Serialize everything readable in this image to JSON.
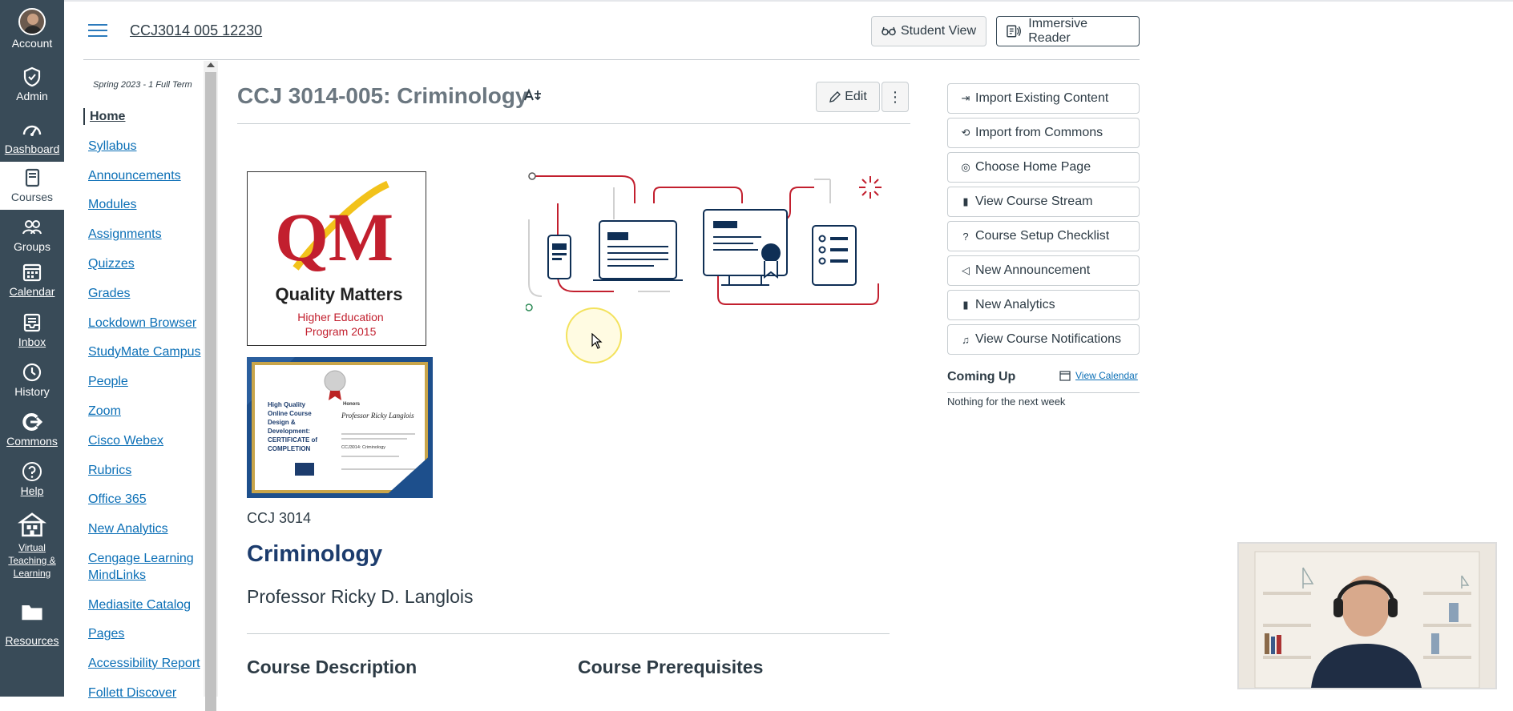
{
  "global_nav": [
    {
      "label": "Account",
      "icon": "avatar"
    },
    {
      "label": "Admin",
      "icon": "shield-icon"
    },
    {
      "label": "Dashboard",
      "icon": "dashboard-icon"
    },
    {
      "label": "Courses",
      "icon": "book-icon"
    },
    {
      "label": "Groups",
      "icon": "groups-icon"
    },
    {
      "label": "Calendar",
      "icon": "calendar-icon"
    },
    {
      "label": "Inbox",
      "icon": "inbox-icon"
    },
    {
      "label": "History",
      "icon": "clock-icon"
    },
    {
      "label": "Commons",
      "icon": "commons-icon"
    },
    {
      "label": "Help",
      "icon": "help-icon"
    },
    {
      "label": "Virtual Teaching & Learning",
      "icon": "building-icon"
    },
    {
      "label": "Resources",
      "icon": "folder-icon"
    }
  ],
  "header": {
    "breadcrumb": "CCJ3014 005 12230",
    "student_view": "Student View",
    "immersive_reader": "Immersive Reader"
  },
  "course_nav": {
    "term": "Spring 2023 - 1 Full Term",
    "links": [
      "Home",
      "Syllabus",
      "Announcements",
      "Modules",
      "Assignments",
      "Quizzes",
      "Grades",
      "Lockdown Browser",
      "StudyMate Campus",
      "People",
      "Zoom",
      "Cisco Webex",
      "Rubrics",
      "Office 365",
      "New Analytics",
      "Cengage Learning MindLinks",
      "Mediasite Catalog",
      "Pages",
      "Accessibility Report",
      "Follett Discover"
    ]
  },
  "content": {
    "title": "CCJ 3014-005: Criminology",
    "edit": "Edit",
    "course_code": "CCJ 3014",
    "course_name": "Criminology",
    "professor": "Professor Ricky D. Langlois",
    "section_description": "Course Description",
    "section_prereq": "Course Prerequisites"
  },
  "qm_badge": {
    "letters": "QM",
    "name": "Quality Matters",
    "line1": "Higher Education",
    "line2": "Program 2015"
  },
  "certificate": {
    "left": [
      "High Quality",
      "Online Course",
      "Design &",
      "Development:",
      "CERTIFICATE of",
      "COMPLETION"
    ],
    "honors": "Honors",
    "recipient": "Professor Ricky Langlois",
    "course": "CCJ3014: Criminology"
  },
  "sidebar": {
    "buttons": [
      {
        "label": "Import Existing Content",
        "icon": "import-icon"
      },
      {
        "label": "Import from Commons",
        "icon": "commons-icon"
      },
      {
        "label": "Choose Home Page",
        "icon": "target-icon"
      },
      {
        "label": "View Course Stream",
        "icon": "bar-chart-icon"
      },
      {
        "label": "Course Setup Checklist",
        "icon": "question-icon"
      },
      {
        "label": "New Announcement",
        "icon": "megaphone-icon"
      },
      {
        "label": "New Analytics",
        "icon": "bar-chart-icon"
      },
      {
        "label": "View Course Notifications",
        "icon": "bell-icon"
      }
    ],
    "coming_up": "Coming Up",
    "view_calendar": "View Calendar",
    "nothing": "Nothing for the next week"
  },
  "colors": {
    "global_nav_bg": "#394b58",
    "link": "#0b6fb6",
    "course_name": "#1c3c6d",
    "qm_red": "#c21f2e",
    "qm_gold": "#f2c21b"
  }
}
